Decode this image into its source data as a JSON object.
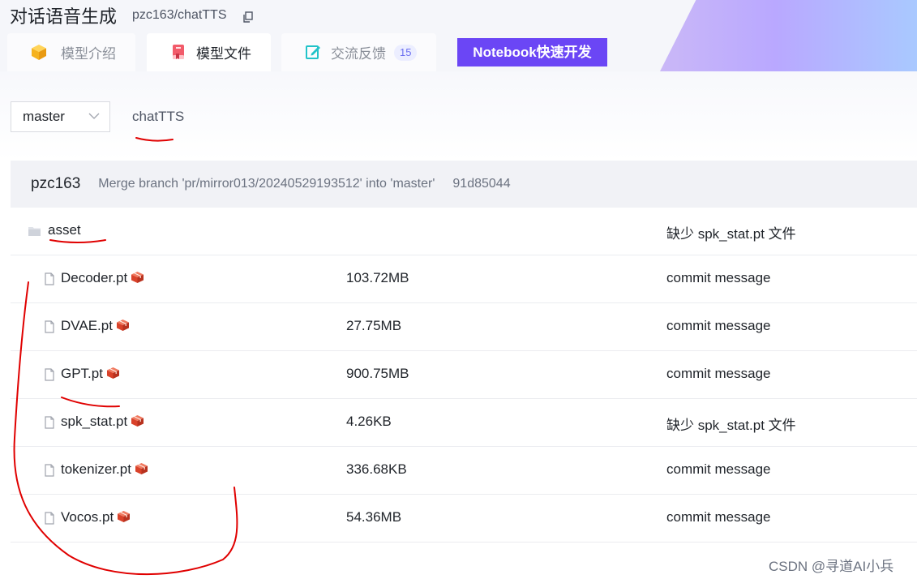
{
  "header": {
    "title": "对话语音生成",
    "repo": "pzc163/chatTTS",
    "tabs": [
      {
        "label": "模型介绍",
        "icon": "cube-icon"
      },
      {
        "label": "模型文件",
        "icon": "book-icon",
        "active": true
      },
      {
        "label": "交流反馈",
        "icon": "edit-icon",
        "badge": "15"
      }
    ],
    "notebook_button": "Notebook快速开发"
  },
  "branch": {
    "selected": "master",
    "path": "chatTTS"
  },
  "commit": {
    "author": "pzc163",
    "message": "Merge branch 'pr/mirror013/20240529193512' into 'master'",
    "hash": "91d85044"
  },
  "files": [
    {
      "name": "asset",
      "type": "folder",
      "size": "",
      "commit": "缺少 spk_stat.pt 文件"
    },
    {
      "name": "Decoder.pt",
      "type": "file",
      "size": "103.72MB",
      "commit": "commit message"
    },
    {
      "name": "DVAE.pt",
      "type": "file",
      "size": "27.75MB",
      "commit": "commit message"
    },
    {
      "name": "GPT.pt",
      "type": "file",
      "size": "900.75MB",
      "commit": "commit message"
    },
    {
      "name": "spk_stat.pt",
      "type": "file",
      "size": "4.26KB",
      "commit": "缺少 spk_stat.pt 文件"
    },
    {
      "name": "tokenizer.pt",
      "type": "file",
      "size": "336.68KB",
      "commit": "commit message"
    },
    {
      "name": "Vocos.pt",
      "type": "file",
      "size": "54.36MB",
      "commit": "commit message"
    }
  ],
  "watermark": "CSDN @寻道AI小兵",
  "colors": {
    "accent": "#6b46f5",
    "annotation": "#e00000"
  }
}
